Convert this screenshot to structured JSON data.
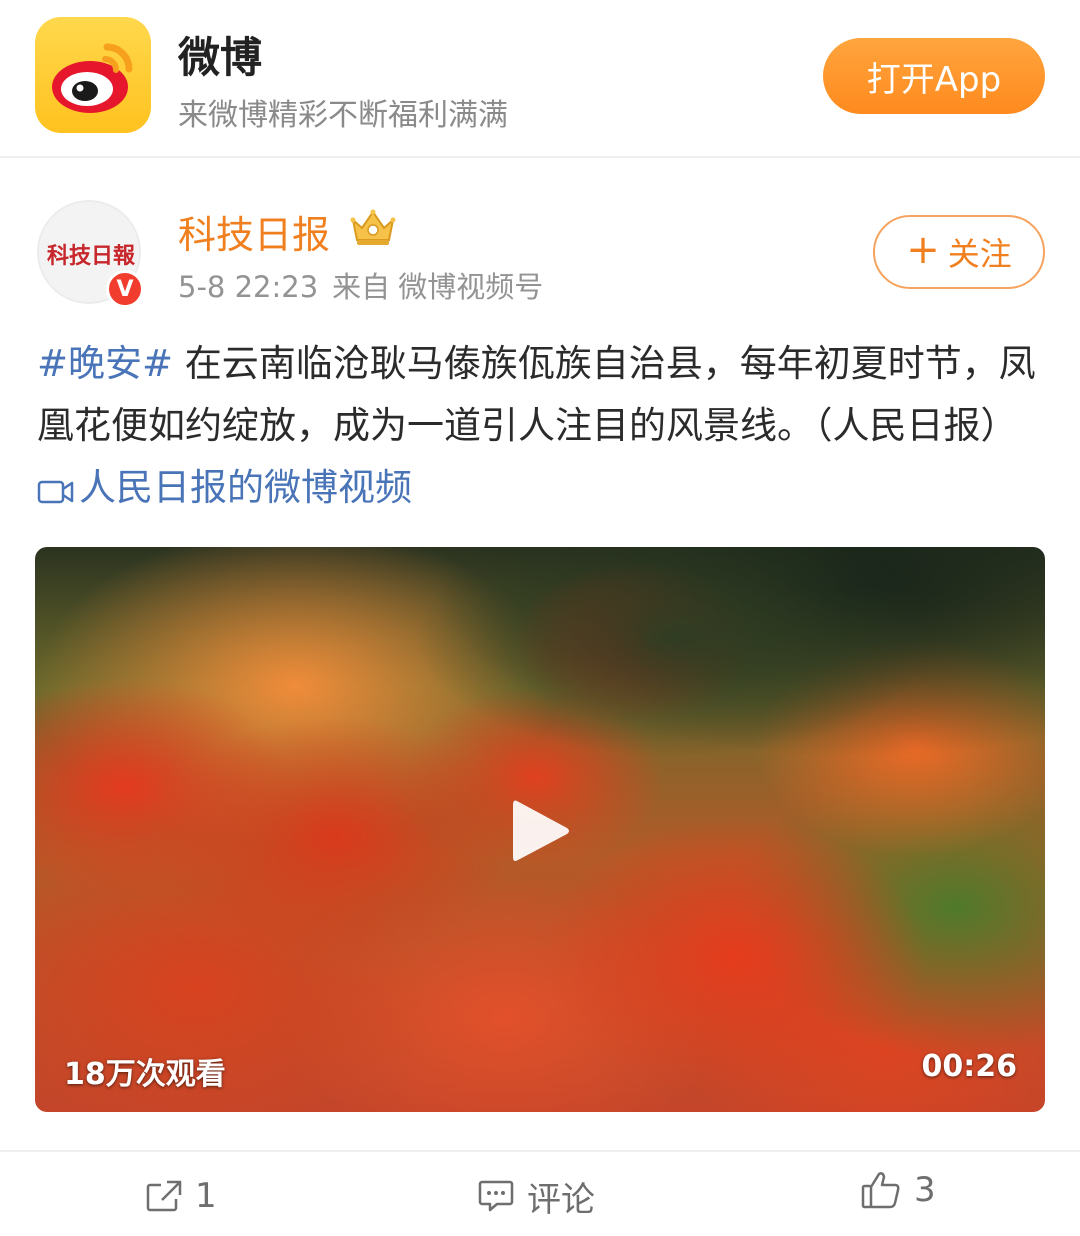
{
  "banner": {
    "app_name": "微博",
    "tagline": "来微博精彩不断福利满满",
    "open_button": "打开App",
    "icon": "weibo-logo-icon"
  },
  "post": {
    "author": {
      "name": "科技日报",
      "avatar_text": "科技日報",
      "verified_badge": "V",
      "badge_icon": "crown-icon"
    },
    "meta": {
      "time": "5-8 22:23",
      "source_prefix": "来自",
      "source": "微博视频号"
    },
    "follow_button": {
      "plus": "+",
      "label": "关注"
    },
    "text": {
      "hashtag": "#晚安#",
      "body": " 在云南临沧耿马傣族佤族自治县，每年初夏时节，凤凰花便如约绽放，成为一道引人注目的风景线。（人民日报）",
      "video_link": "人民日报的微博视频"
    },
    "video": {
      "view_count": "18万次观看",
      "duration": "00:26",
      "play_icon": "play-icon"
    },
    "actions": {
      "repost_count": "1",
      "comment_label": "评论",
      "like_count": "3"
    }
  },
  "colors": {
    "accent_orange": "#f0801f",
    "link_blue": "#4a74b8",
    "button_orange": "#ff9a2e",
    "verified_red": "#f13d2d"
  }
}
